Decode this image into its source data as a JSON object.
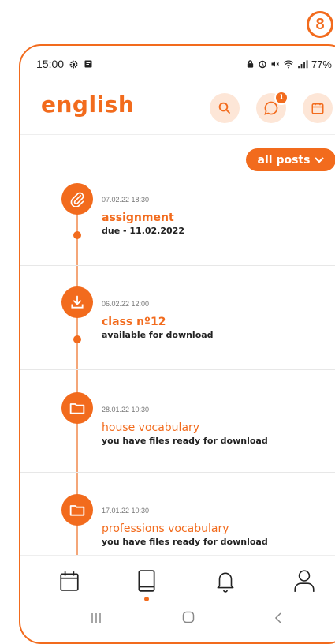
{
  "step_badge": "8",
  "status_bar": {
    "time": "15:00",
    "battery": "77%"
  },
  "header": {
    "title": "english",
    "notification_count": "1"
  },
  "filter": {
    "label": "all posts"
  },
  "posts": [
    {
      "date": "07.02.22  18:30",
      "title": "assignment",
      "subtitle": "due - 11.02.2022",
      "icon": "paperclip-icon"
    },
    {
      "date": "06.02.22  12:00",
      "title": "class nº12",
      "subtitle": "available for download",
      "icon": "download-icon"
    },
    {
      "date": "28.01.22  10:30",
      "title": "house vocabulary",
      "subtitle": "you have files ready for download",
      "icon": "folder-icon"
    },
    {
      "date": "17.01.22 10:30",
      "title": "professions vocabulary",
      "subtitle": "you have files ready for download",
      "icon": "folder-icon"
    }
  ],
  "bottom_nav": [
    "calendar-icon",
    "book-icon",
    "bell-icon",
    "profile-icon"
  ],
  "colors": {
    "accent": "#f26b1d",
    "accent_light": "#fde6d7"
  }
}
